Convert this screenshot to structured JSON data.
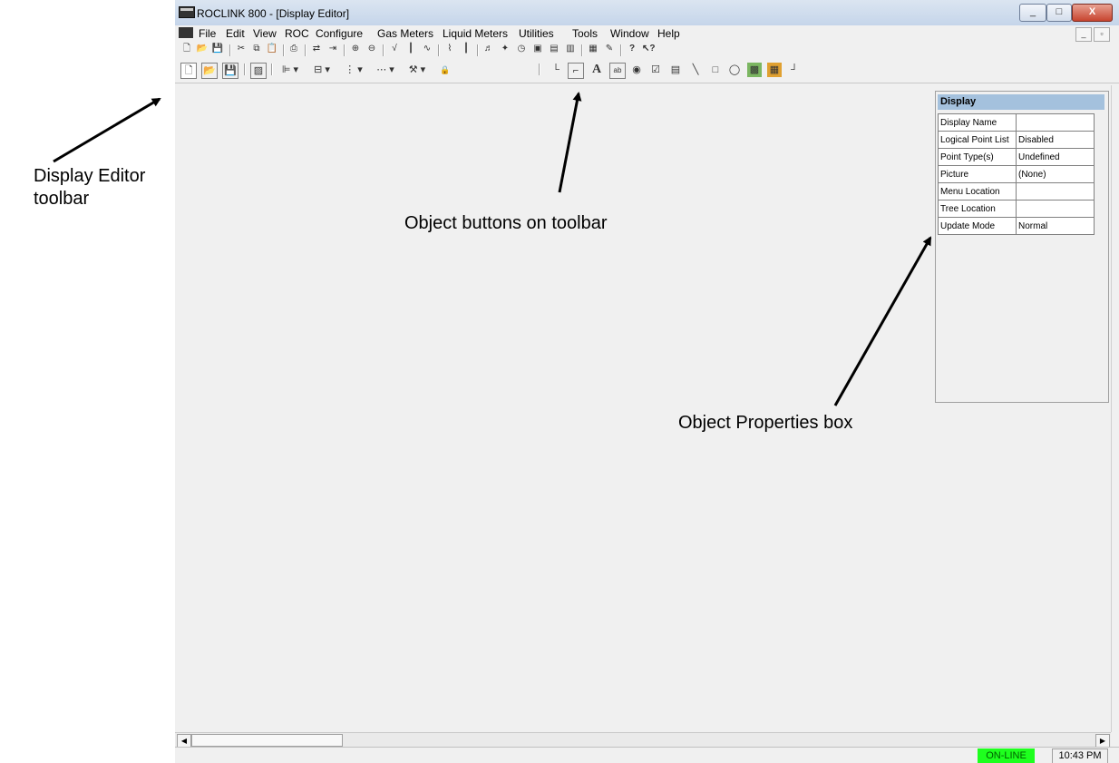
{
  "window": {
    "title": "ROCLINK 800 - [Display Editor]",
    "minimize": "_",
    "maximize": "□",
    "close": "X"
  },
  "menu": {
    "items": [
      "File",
      "Edit",
      "View",
      "ROC",
      "Configure",
      "Gas Meters",
      "Liquid Meters",
      "Utilities",
      "Tools",
      "Window",
      "Help"
    ],
    "mdi_min": "_",
    "mdi_restore": "▫"
  },
  "toolbar_std": {
    "icons": [
      "new-icon",
      "open-icon",
      "save-icon",
      "cut-icon",
      "copy-icon",
      "paste-icon",
      "print-icon",
      "connect-icon",
      "disconnect-icon",
      "zoom-in-icon",
      "zoom-out-icon",
      "trend-icon",
      "bars-icon",
      "graph-icon",
      "signal-icon",
      "column-icon",
      "flow-icon",
      "flame-icon",
      "clock-icon",
      "panel-icon",
      "monitor-icon",
      "display-icon",
      "chart-icon",
      "edit-icon",
      "help-icon",
      "context-help-icon"
    ]
  },
  "toolbar_editor": {
    "icons": [
      "new-icon",
      "open-icon",
      "save-icon",
      "form-icon",
      "align-icon",
      "layout-icon",
      "distribute-icon",
      "spacing-icon",
      "tools-icon",
      "lock-icon"
    ],
    "objects": [
      "frame-icon",
      "group-box-icon",
      "text-icon",
      "textbox-icon",
      "radio-icon",
      "checkbox-icon",
      "list-icon",
      "line-icon",
      "rectangle-icon",
      "ellipse-icon",
      "image-icon",
      "grid-icon",
      "end-icon"
    ]
  },
  "props": {
    "header": "Display",
    "rows": [
      {
        "key": "Display Name",
        "value": ""
      },
      {
        "key": "Logical Point List",
        "value": "Disabled"
      },
      {
        "key": "Point Type(s)",
        "value": "Undefined"
      },
      {
        "key": "Picture",
        "value": "(None)"
      },
      {
        "key": "Menu Location",
        "value": ""
      },
      {
        "key": "Tree Location",
        "value": ""
      },
      {
        "key": "Update Mode",
        "value": "Normal"
      }
    ]
  },
  "status": {
    "online": "ON-LINE",
    "time": "10:43 PM"
  },
  "annotations": {
    "editor_toolbar_line1": "Display Editor",
    "editor_toolbar_line2": "toolbar",
    "object_buttons": "Object buttons on toolbar",
    "props_box": "Object Properties box"
  }
}
